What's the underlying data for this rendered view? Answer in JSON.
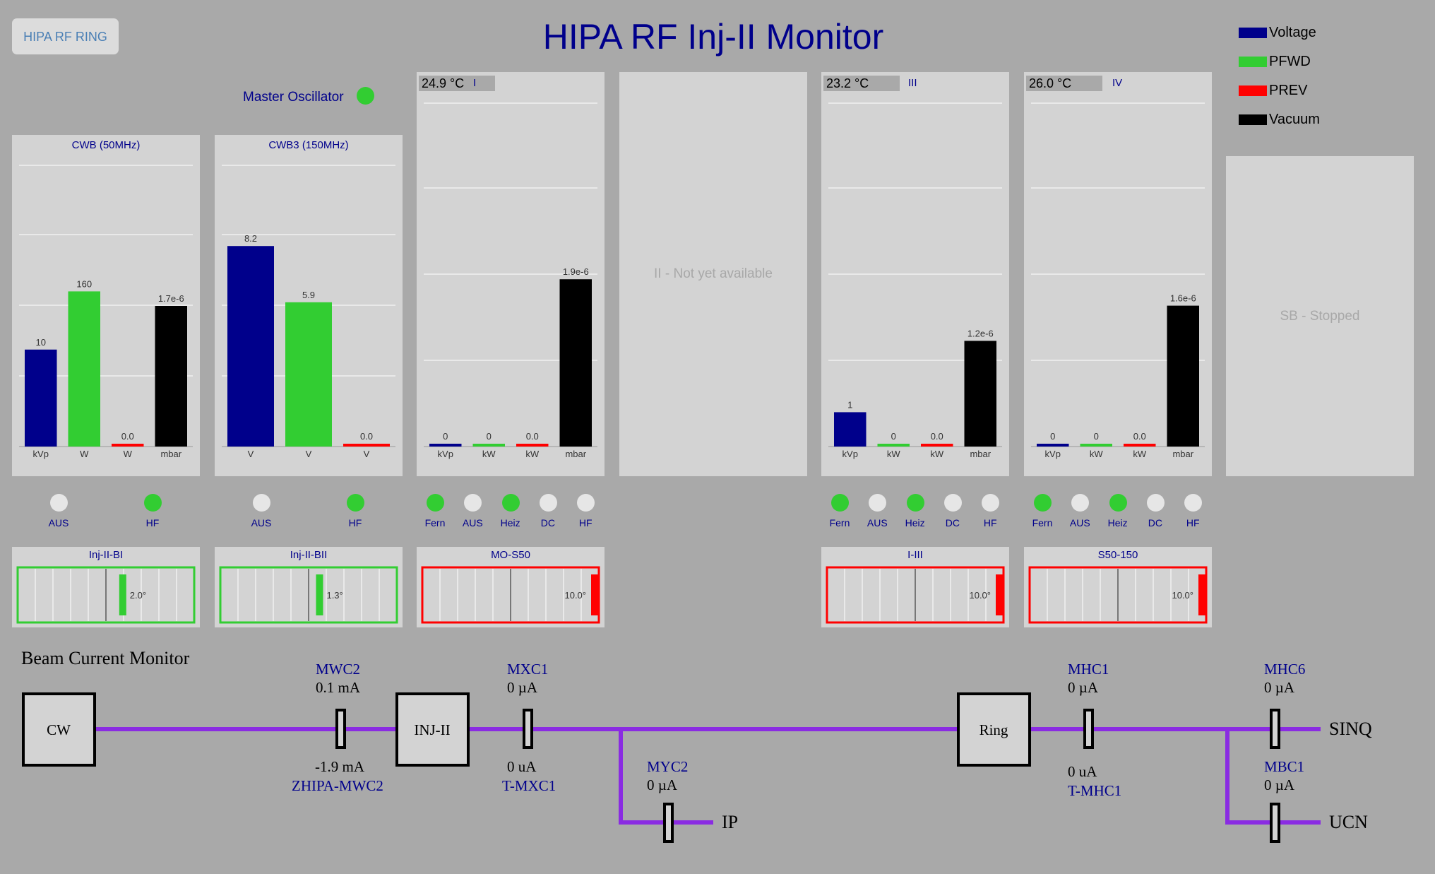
{
  "header": {
    "ring_button": "HIPA RF RING",
    "title": "HIPA RF Inj-II Monitor"
  },
  "legend": [
    {
      "label": "Voltage",
      "color": "#00008b"
    },
    {
      "label": "PFWD",
      "color": "#32cd32"
    },
    {
      "label": "PREV",
      "color": "#ff0000"
    },
    {
      "label": "Vacuum",
      "color": "#000000"
    }
  ],
  "master_oscillator": {
    "label": "Master Oscillator",
    "status": "on"
  },
  "charts": [
    {
      "id": "cwb",
      "title": "CWB (50MHz)",
      "temperature": "",
      "bars": [
        {
          "label": "10",
          "value": 10,
          "unit": "kVp",
          "color": "#00008b"
        },
        {
          "label": "160",
          "value": 160,
          "unit": "W",
          "color": "#32cd32"
        },
        {
          "label": "0.0",
          "value": 0.0,
          "unit": "W",
          "color": "#ff0000"
        },
        {
          "label": "1.7e-6",
          "value": 1.7e-06,
          "unit": "mbar",
          "color": "#000000"
        }
      ]
    },
    {
      "id": "cwb3",
      "title": "CWB3 (150MHz)",
      "temperature": "",
      "bars": [
        {
          "label": "8.2",
          "value": 8.2,
          "unit": "V",
          "color": "#00008b"
        },
        {
          "label": "5.9",
          "value": 5.9,
          "unit": "V",
          "color": "#32cd32"
        },
        {
          "label": "0.0",
          "value": 0.0,
          "unit": "V",
          "color": "#ff0000"
        }
      ]
    },
    {
      "id": "cav1",
      "title": "I",
      "temperature": "24.9 °C",
      "bars": [
        {
          "label": "0",
          "value": 0,
          "unit": "kVp",
          "color": "#00008b"
        },
        {
          "label": "0",
          "value": 0,
          "unit": "kW",
          "color": "#32cd32"
        },
        {
          "label": "0.0",
          "value": 0.0,
          "unit": "kW",
          "color": "#ff0000"
        },
        {
          "label": "1.9e-6",
          "value": 1.9e-06,
          "unit": "mbar",
          "color": "#000000"
        }
      ]
    },
    {
      "id": "cav3",
      "title": "III",
      "temperature": "23.2 °C",
      "bars": [
        {
          "label": "1",
          "value": 1,
          "unit": "kVp",
          "color": "#00008b"
        },
        {
          "label": "0",
          "value": 0,
          "unit": "kW",
          "color": "#32cd32"
        },
        {
          "label": "0.0",
          "value": 0.0,
          "unit": "kW",
          "color": "#ff0000"
        },
        {
          "label": "1.2e-6",
          "value": 1.2e-06,
          "unit": "mbar",
          "color": "#000000"
        }
      ]
    },
    {
      "id": "cav4",
      "title": "IV",
      "temperature": "26.0 °C",
      "bars": [
        {
          "label": "0",
          "value": 0,
          "unit": "kVp",
          "color": "#00008b"
        },
        {
          "label": "0",
          "value": 0,
          "unit": "kW",
          "color": "#32cd32"
        },
        {
          "label": "0.0",
          "value": 0.0,
          "unit": "kW",
          "color": "#ff0000"
        },
        {
          "label": "1.6e-6",
          "value": 1.6e-06,
          "unit": "mbar",
          "color": "#000000"
        }
      ]
    }
  ],
  "unavailable": {
    "cav2": "II - Not yet available",
    "sb": "SB - Stopped"
  },
  "status_groups": [
    {
      "panel": "cwb",
      "leds": [
        {
          "label": "AUS",
          "on": false
        },
        {
          "label": "HF",
          "on": true
        }
      ]
    },
    {
      "panel": "cwb3",
      "leds": [
        {
          "label": "AUS",
          "on": false
        },
        {
          "label": "HF",
          "on": true
        }
      ]
    },
    {
      "panel": "cav1",
      "leds": [
        {
          "label": "Fern",
          "on": true
        },
        {
          "label": "AUS",
          "on": false
        },
        {
          "label": "Heiz",
          "on": true
        },
        {
          "label": "DC",
          "on": false
        },
        {
          "label": "HF",
          "on": false
        }
      ]
    },
    {
      "panel": "cav3",
      "leds": [
        {
          "label": "Fern",
          "on": true
        },
        {
          "label": "AUS",
          "on": false
        },
        {
          "label": "Heiz",
          "on": true
        },
        {
          "label": "DC",
          "on": false
        },
        {
          "label": "HF",
          "on": false
        }
      ]
    },
    {
      "panel": "cav4",
      "leds": [
        {
          "label": "Fern",
          "on": true
        },
        {
          "label": "AUS",
          "on": false
        },
        {
          "label": "Heiz",
          "on": true
        },
        {
          "label": "DC",
          "on": false
        },
        {
          "label": "HF",
          "on": false
        }
      ]
    }
  ],
  "phase_meters": [
    {
      "panel": "cwb",
      "title": "Inj-II-BI",
      "value_label": "2.0°",
      "value": 2.0,
      "max": 10,
      "ok": true
    },
    {
      "panel": "cwb3",
      "title": "Inj-II-BII",
      "value_label": "1.3°",
      "value": 1.3,
      "max": 10,
      "ok": true
    },
    {
      "panel": "cav1",
      "title": "MO-S50",
      "value_label": "10.0°",
      "value": 10.0,
      "max": 10,
      "ok": false
    },
    {
      "panel": "cav3",
      "title": "I-III",
      "value_label": "10.0°",
      "value": 10.0,
      "max": 10,
      "ok": false
    },
    {
      "panel": "cav4",
      "title": "S50-150",
      "value_label": "10.0°",
      "value": 10.0,
      "max": 10,
      "ok": false
    }
  ],
  "beam": {
    "title": "Beam Current Monitor",
    "boxes": {
      "cw": "CW",
      "inj": "INJ-II",
      "ring": "Ring"
    },
    "monitors": {
      "mwc2": {
        "name": "MWC2",
        "value": "0.1 mA"
      },
      "zhipa": {
        "name": "ZHIPA-MWC2",
        "value": "-1.9 mA"
      },
      "mxc1": {
        "name": "MXC1",
        "value": "0 µA"
      },
      "tmxc1": {
        "name": "T-MXC1",
        "value": "0 uA"
      },
      "myc2": {
        "name": "MYC2",
        "value": "0 µA"
      },
      "mhc1": {
        "name": "MHC1",
        "value": "0 µA"
      },
      "tmhc1": {
        "name": "T-MHC1",
        "value": "0 uA"
      },
      "mhc6": {
        "name": "MHC6",
        "value": "0 µA"
      },
      "mbc1": {
        "name": "MBC1",
        "value": "0 µA"
      }
    },
    "targets": {
      "ip": "IP",
      "sinq": "SINQ",
      "ucn": "UCN"
    }
  }
}
